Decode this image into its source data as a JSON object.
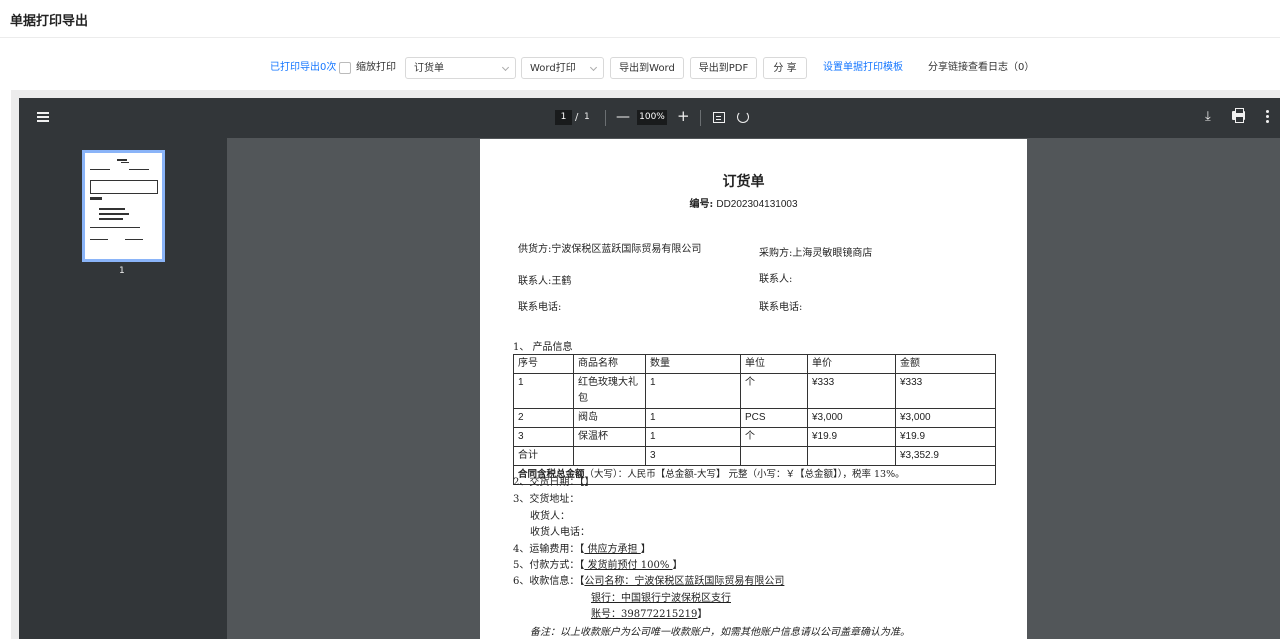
{
  "page": {
    "title": "单据打印导出"
  },
  "toolbar": {
    "print_count": "已打印导出0次",
    "scale_print_label": "缩放打印",
    "template_select": "订货单",
    "print_mode_select": "Word打印",
    "export_word": "导出到Word",
    "export_pdf": "导出到PDF",
    "share": "分 享",
    "set_template": "设置单据打印模板",
    "share_log": "分享链接查看日志（0）"
  },
  "viewer": {
    "page_current": "1",
    "page_sep": "/",
    "page_total": "1",
    "zoom": "100%",
    "zoom_out": "—",
    "zoom_in": "+",
    "download_glyph": "⤓",
    "thumbnail_number": "1"
  },
  "document": {
    "title": "订货单",
    "number_label": "编号:",
    "number": "DD202304131003",
    "supplier_label": "供货方:",
    "supplier": "宁波保税区蓝跃国际贸易有限公司",
    "buyer_label": "采购方:",
    "buyer": "上海灵敏眼镜商店",
    "supplier_contact_label": "联系人:",
    "supplier_contact": "王鹤",
    "buyer_contact_label": "联系人:",
    "supplier_phone_label": "联系电话:",
    "buyer_phone_label": "联系电话:",
    "section1": "1、 产品信息",
    "table_headers": [
      "序号",
      "商品名称",
      "数量",
      "单位",
      "单价",
      "金额"
    ],
    "rows": [
      [
        "1",
        "红色玫瑰大礼包",
        "1",
        "个",
        "¥333",
        "¥333"
      ],
      [
        "2",
        "阀岛",
        "1",
        "PCS",
        "¥3,000",
        "¥3,000"
      ],
      [
        "3",
        "保温杯",
        "1",
        "个",
        "¥19.9",
        "¥19.9"
      ]
    ],
    "total_row": [
      "合计",
      "",
      "3",
      "",
      "",
      "¥3,352.9"
    ],
    "contract_total_label": "合同含税总金额",
    "contract_total_text": "（大写）：人民币【总金额-大写】 元整（小写：￥【总金额】），税率 13%。",
    "delivery_date": "2、交货日期：【】",
    "delivery_address": "3、交货地址：",
    "receiver": "收货人：",
    "receiver_phone": "收货人电话：",
    "freight_label": "4、运输费用：【",
    "freight_value": "  供应方承担  ",
    "payment_label": "5、付款方式：【",
    "payment_value": "    发货前预付 100%   ",
    "collection_label": "6、收款信息：【",
    "company_name": "公司名称：宁波保税区蓝跃国际贸易有限公司",
    "bank": "银行：中国银行宁波保税区支行",
    "account": "账号：398772215219",
    "closing_bracket": "】",
    "note": "备注：以上收款账户为公司唯一收款账户，如需其他账户信息请以公司盖章确认为准。"
  }
}
